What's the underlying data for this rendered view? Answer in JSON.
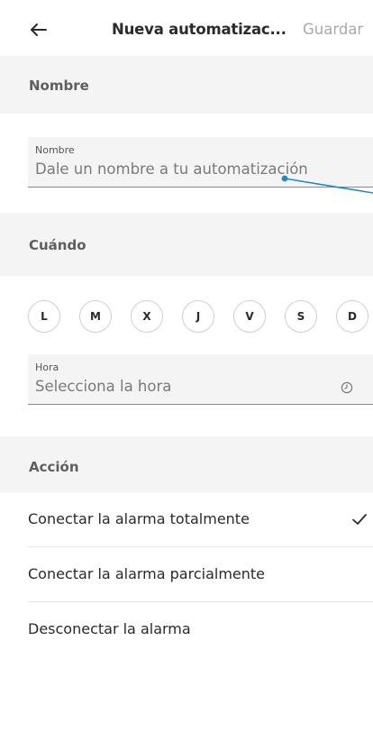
{
  "header": {
    "back_icon": "arrow-left-icon",
    "title": "Nueva automatizac...",
    "save_label": "Guardar"
  },
  "sections": {
    "name": "Nombre",
    "when": "Cuándo",
    "action": "Acción"
  },
  "name_field": {
    "label": "Nombre",
    "placeholder": "Dale un nombre a tu automatización"
  },
  "days": [
    "L",
    "M",
    "X",
    "J",
    "V",
    "S",
    "D"
  ],
  "time_field": {
    "label": "Hora",
    "placeholder": "Selecciona la hora",
    "icon": "clock-icon"
  },
  "actions": [
    {
      "label": "Conectar la alarma totalmente",
      "selected": true
    },
    {
      "label": "Conectar la alarma parcialmente",
      "selected": false
    },
    {
      "label": "Desconectar la alarma",
      "selected": false
    }
  ],
  "colors": {
    "annotation_arrow": "#1e88c9",
    "section_bg": "#f4f4f4"
  }
}
